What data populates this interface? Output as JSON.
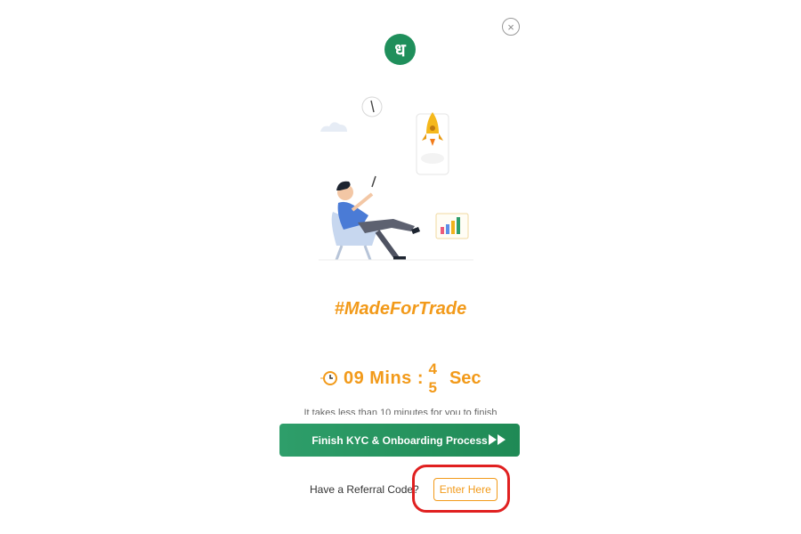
{
  "close": {
    "symbol": "×",
    "icon": "close-icon"
  },
  "logo": {
    "glyph": "ध",
    "color": "#1f8f5b"
  },
  "tagline": "#MadeForTrade",
  "timer": {
    "minutes": "09",
    "mins_label": "Mins",
    "separator": ":",
    "sec_digit_1": "4",
    "sec_digit_2": "5",
    "sec_label": "Sec",
    "icon": "clock-icon"
  },
  "hint": "It takes less than 10 minutes for you to finish",
  "primary_button": {
    "label": "Finish KYC & Onboarding Process",
    "icon": "fast-forward-icon"
  },
  "referral": {
    "prompt": "Have a Referral Code?",
    "button_label": "Enter Here"
  },
  "colors": {
    "accent": "#f29a1a",
    "brand": "#1f8f5b",
    "highlight": "#e02020"
  }
}
